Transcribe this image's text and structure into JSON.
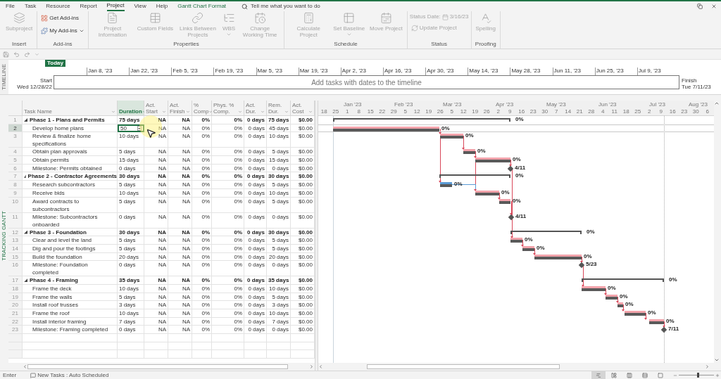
{
  "tabs": [
    {
      "label": "File",
      "selected": false,
      "kind": "tab"
    },
    {
      "label": "Task",
      "selected": false,
      "kind": "tab"
    },
    {
      "label": "Resource",
      "selected": false,
      "kind": "tab"
    },
    {
      "label": "Report",
      "selected": false,
      "kind": "tab"
    },
    {
      "label": "Project",
      "selected": true,
      "kind": "tab"
    },
    {
      "label": "View",
      "selected": false,
      "kind": "tab"
    },
    {
      "label": "Help",
      "selected": false,
      "kind": "tab"
    },
    {
      "label": "Gantt Chart Format",
      "selected": false,
      "kind": "contextual"
    }
  ],
  "search": {
    "placeholder": "Tell me what you want to do"
  },
  "ribbon": [
    {
      "label": "Insert",
      "buttons": [
        {
          "kind": "large",
          "label": "Subproject",
          "disabled": true,
          "menu": false
        }
      ]
    },
    {
      "label": "Add-ins",
      "buttons": [
        {
          "kind": "small",
          "label": "Get Add-ins",
          "disabled": false,
          "menu": false
        },
        {
          "kind": "small",
          "label": "My Add-ins",
          "disabled": false,
          "menu": true
        }
      ]
    },
    {
      "label": "Properties",
      "buttons": [
        {
          "kind": "large",
          "label": "Project Information",
          "disabled": true,
          "menu": false
        },
        {
          "kind": "large",
          "label": "Custom Fields",
          "disabled": true,
          "menu": false
        },
        {
          "kind": "large",
          "label": "Links Between Projects",
          "disabled": true,
          "menu": false
        },
        {
          "kind": "large",
          "label": "WBS",
          "disabled": true,
          "menu": true
        },
        {
          "kind": "large",
          "label": "Change Working Time",
          "disabled": true,
          "menu": false
        }
      ]
    },
    {
      "label": "Schedule",
      "buttons": [
        {
          "kind": "large",
          "label": "Calculate Project",
          "disabled": true,
          "menu": false
        },
        {
          "kind": "large",
          "label": "Set Baseline",
          "disabled": true,
          "menu": true
        },
        {
          "kind": "large",
          "label": "Move Project",
          "disabled": true,
          "menu": false
        }
      ]
    },
    {
      "label": "Status",
      "buttons": [
        {
          "kind": "field",
          "label": "Status Date:",
          "value": "3/16/23",
          "disabled": true,
          "menu": false
        },
        {
          "kind": "small",
          "label": "Update Project",
          "disabled": true,
          "menu": false
        }
      ]
    },
    {
      "label": "Proofing",
      "buttons": [
        {
          "kind": "large",
          "label": "Spelling",
          "disabled": true,
          "menu": false
        }
      ]
    }
  ],
  "timeline": {
    "side_label": "TIMELINE",
    "today": "Today",
    "start_label": "Start",
    "start_date": "Wed 12/28/22",
    "finish_label": "Finish",
    "finish_date": "Tue 7/11/23",
    "placeholder": "Add tasks with dates to the timeline",
    "dates": [
      "Jan 8, '23",
      "Jan 22, '23",
      "Feb 5, '23",
      "Feb 19, '23",
      "Mar 5, '23",
      "Mar 19, '23",
      "Apr 2, '23",
      "Apr 16, '23",
      "Apr 30, '23",
      "May 14, '23",
      "May 28, '23",
      "Jun 11, '23",
      "Jun 25, '23",
      "Jul 9, '23"
    ]
  },
  "view": {
    "side_label": "TRACKING GANTT",
    "columns": [
      {
        "label": "Task Name",
        "selected": false
      },
      {
        "label": "Duration",
        "selected": true
      },
      {
        "label": "Act. Start",
        "selected": false
      },
      {
        "label": "Act. Finish",
        "selected": false
      },
      {
        "label": "% Comp",
        "selected": false
      },
      {
        "label": "Phys. % Comp.",
        "selected": false
      },
      {
        "label": "Act. Dur.",
        "selected": false
      },
      {
        "label": "Rem. Dur.",
        "selected": false
      },
      {
        "label": "Act. Cost",
        "selected": false
      }
    ],
    "months": [
      "Jan '23",
      "Feb '23",
      "Mar '23",
      "Apr '23",
      "May '23",
      "Jun '23",
      "Jul '23",
      "Aug '23"
    ],
    "weeks": [
      "18",
      "25",
      "1",
      "8",
      "15",
      "22",
      "29",
      "5",
      "12",
      "19",
      "26",
      "5",
      "12",
      "19",
      "26",
      "2",
      "9",
      "16",
      "23",
      "30",
      "7",
      "14",
      "21",
      "28",
      "4",
      "11",
      "18",
      "25",
      "2",
      "9",
      "16",
      "23",
      "30",
      "6"
    ]
  },
  "tasks": [
    {
      "num": "1",
      "name": "Phase 1 - Plans and Permits",
      "kind": "summary",
      "expanded": true,
      "critical": true,
      "selected": false,
      "editing": false,
      "duration": "75 days",
      "act_start": "NA",
      "act_finish": "NA",
      "pct_comp": "0%",
      "phys_comp": "0%",
      "act_dur": "0 days",
      "rem_dur": "75 days",
      "act_cost": "$0.00",
      "bar_label": "0%"
    },
    {
      "num": "2",
      "name": "Develop home plans",
      "kind": "task",
      "critical": true,
      "selected": true,
      "editing": true,
      "duration": "50",
      "act_start": "NA",
      "act_finish": "NA",
      "pct_comp": "0%",
      "phys_comp": "0%",
      "act_dur": "0 days",
      "rem_dur": "45 days",
      "act_cost": "$0.00",
      "bar_label": "0%"
    },
    {
      "num": "3",
      "name": "Review & finalize home specifications",
      "kind": "task",
      "critical": true,
      "selected": false,
      "editing": false,
      "duration": "10 days",
      "act_start": "NA",
      "act_finish": "NA",
      "pct_comp": "0%",
      "phys_comp": "0%",
      "act_dur": "0 days",
      "rem_dur": "10 days",
      "act_cost": "$0.00",
      "bar_label": "0%"
    },
    {
      "num": "4",
      "name": "Obtain plan approvals",
      "kind": "task",
      "critical": true,
      "selected": false,
      "editing": false,
      "duration": "5 days",
      "act_start": "NA",
      "act_finish": "NA",
      "pct_comp": "0%",
      "phys_comp": "0%",
      "act_dur": "0 days",
      "rem_dur": "5 days",
      "act_cost": "$0.00",
      "bar_label": "0%"
    },
    {
      "num": "5",
      "name": "Obtain permits",
      "kind": "task",
      "critical": true,
      "selected": false,
      "editing": false,
      "duration": "15 days",
      "act_start": "NA",
      "act_finish": "NA",
      "pct_comp": "0%",
      "phys_comp": "0%",
      "act_dur": "0 days",
      "rem_dur": "15 days",
      "act_cost": "$0.00",
      "bar_label": "0%"
    },
    {
      "num": "6",
      "name": "Milestone: Permits obtained",
      "kind": "milestone",
      "critical": true,
      "selected": false,
      "editing": false,
      "duration": "0 days",
      "act_start": "NA",
      "act_finish": "NA",
      "pct_comp": "0%",
      "phys_comp": "0%",
      "act_dur": "0 days",
      "rem_dur": "0 days",
      "act_cost": "$0.00",
      "bar_label": "4/11"
    },
    {
      "num": "7",
      "name": "Phase 2 - Contractor Agreements",
      "kind": "summary",
      "expanded": true,
      "critical": true,
      "selected": false,
      "editing": false,
      "duration": "30 days",
      "act_start": "NA",
      "act_finish": "NA",
      "pct_comp": "0%",
      "phys_comp": "0%",
      "act_dur": "0 days",
      "rem_dur": "30 days",
      "act_cost": "$0.00",
      "bar_label": "0%"
    },
    {
      "num": "8",
      "name": "Research subcontractors",
      "kind": "task",
      "critical": false,
      "selected": false,
      "editing": false,
      "duration": "5 days",
      "act_start": "NA",
      "act_finish": "NA",
      "pct_comp": "0%",
      "phys_comp": "0%",
      "act_dur": "0 days",
      "rem_dur": "5 days",
      "act_cost": "$0.00",
      "bar_label": "0%"
    },
    {
      "num": "9",
      "name": "Receive bids",
      "kind": "task",
      "critical": true,
      "selected": false,
      "editing": false,
      "duration": "10 days",
      "act_start": "NA",
      "act_finish": "NA",
      "pct_comp": "0%",
      "phys_comp": "0%",
      "act_dur": "0 days",
      "rem_dur": "10 days",
      "act_cost": "$0.00",
      "bar_label": "0%"
    },
    {
      "num": "10",
      "name": "Award contracts to subcontractors",
      "kind": "task",
      "critical": true,
      "selected": false,
      "editing": false,
      "duration": "5 days",
      "act_start": "NA",
      "act_finish": "NA",
      "pct_comp": "0%",
      "phys_comp": "0%",
      "act_dur": "0 days",
      "rem_dur": "5 days",
      "act_cost": "$0.00",
      "bar_label": "0%"
    },
    {
      "num": "11",
      "name": "Milestone: Subcontractors onboarded",
      "kind": "milestone",
      "critical": true,
      "selected": false,
      "editing": false,
      "duration": "0 days",
      "act_start": "NA",
      "act_finish": "NA",
      "pct_comp": "0%",
      "phys_comp": "0%",
      "act_dur": "0 days",
      "rem_dur": "0 days",
      "act_cost": "$0.00",
      "bar_label": "4/11"
    },
    {
      "num": "12",
      "name": "Phase 3 - Foundation",
      "kind": "summary",
      "expanded": true,
      "critical": true,
      "selected": false,
      "editing": false,
      "duration": "30 days",
      "act_start": "NA",
      "act_finish": "NA",
      "pct_comp": "0%",
      "phys_comp": "0%",
      "act_dur": "0 days",
      "rem_dur": "30 days",
      "act_cost": "$0.00",
      "bar_label": "0%"
    },
    {
      "num": "13",
      "name": "Clear and level the land",
      "kind": "task",
      "critical": true,
      "selected": false,
      "editing": false,
      "duration": "5 days",
      "act_start": "NA",
      "act_finish": "NA",
      "pct_comp": "0%",
      "phys_comp": "0%",
      "act_dur": "0 days",
      "rem_dur": "5 days",
      "act_cost": "$0.00",
      "bar_label": "0%"
    },
    {
      "num": "14",
      "name": "Dig and pour the footings",
      "kind": "task",
      "critical": true,
      "selected": false,
      "editing": false,
      "duration": "5 days",
      "act_start": "NA",
      "act_finish": "NA",
      "pct_comp": "0%",
      "phys_comp": "0%",
      "act_dur": "0 days",
      "rem_dur": "5 days",
      "act_cost": "$0.00",
      "bar_label": "0%"
    },
    {
      "num": "15",
      "name": "Build the foundation",
      "kind": "task",
      "critical": true,
      "selected": false,
      "editing": false,
      "duration": "20 days",
      "act_start": "NA",
      "act_finish": "NA",
      "pct_comp": "0%",
      "phys_comp": "0%",
      "act_dur": "0 days",
      "rem_dur": "20 days",
      "act_cost": "$0.00",
      "bar_label": "0%"
    },
    {
      "num": "16",
      "name": "Milestone: Foundation completed",
      "kind": "milestone",
      "critical": true,
      "selected": false,
      "editing": false,
      "duration": "0 days",
      "act_start": "NA",
      "act_finish": "NA",
      "pct_comp": "0%",
      "phys_comp": "0%",
      "act_dur": "0 days",
      "rem_dur": "0 days",
      "act_cost": "$0.00",
      "bar_label": "5/23"
    },
    {
      "num": "17",
      "name": "Phase 4 - Framing",
      "kind": "summary",
      "expanded": true,
      "critical": true,
      "selected": false,
      "editing": false,
      "duration": "35 days",
      "act_start": "NA",
      "act_finish": "NA",
      "pct_comp": "0%",
      "phys_comp": "0%",
      "act_dur": "0 days",
      "rem_dur": "35 days",
      "act_cost": "$0.00",
      "bar_label": "0%"
    },
    {
      "num": "18",
      "name": "Frame the deck",
      "kind": "task",
      "critical": true,
      "selected": false,
      "editing": false,
      "duration": "10 days",
      "act_start": "NA",
      "act_finish": "NA",
      "pct_comp": "0%",
      "phys_comp": "0%",
      "act_dur": "0 days",
      "rem_dur": "10 days",
      "act_cost": "$0.00",
      "bar_label": "0%"
    },
    {
      "num": "19",
      "name": "Frame the walls",
      "kind": "task",
      "critical": true,
      "selected": false,
      "editing": false,
      "duration": "5 days",
      "act_start": "NA",
      "act_finish": "NA",
      "pct_comp": "0%",
      "phys_comp": "0%",
      "act_dur": "0 days",
      "rem_dur": "5 days",
      "act_cost": "$0.00",
      "bar_label": "0%"
    },
    {
      "num": "20",
      "name": "Install roof trusses",
      "kind": "task",
      "critical": true,
      "selected": false,
      "editing": false,
      "duration": "3 days",
      "act_start": "NA",
      "act_finish": "NA",
      "pct_comp": "0%",
      "phys_comp": "0%",
      "act_dur": "0 days",
      "rem_dur": "3 days",
      "act_cost": "$0.00",
      "bar_label": "0%"
    },
    {
      "num": "21",
      "name": "Frame the roof",
      "kind": "task",
      "critical": true,
      "selected": false,
      "editing": false,
      "duration": "10 days",
      "act_start": "NA",
      "act_finish": "NA",
      "pct_comp": "0%",
      "phys_comp": "0%",
      "act_dur": "0 days",
      "rem_dur": "10 days",
      "act_cost": "$0.00",
      "bar_label": "0%"
    },
    {
      "num": "22",
      "name": "Install interior framing",
      "kind": "task",
      "critical": true,
      "selected": false,
      "editing": false,
      "duration": "7 days",
      "act_start": "NA",
      "act_finish": "NA",
      "pct_comp": "0%",
      "phys_comp": "0%",
      "act_dur": "0 days",
      "rem_dur": "7 days",
      "act_cost": "$0.00",
      "bar_label": "0%"
    },
    {
      "num": "23",
      "name": "Milestone: Framing completed",
      "kind": "milestone",
      "critical": true,
      "selected": false,
      "editing": false,
      "duration": "0 days",
      "act_start": "NA",
      "act_finish": "NA",
      "pct_comp": "0%",
      "phys_comp": "0%",
      "act_dur": "0 days",
      "rem_dur": "0 days",
      "act_cost": "$0.00",
      "bar_label": "7/11"
    }
  ],
  "status_bar": {
    "mode": "Enter",
    "new_tasks": "New Tasks : Auto Scheduled",
    "views": [
      {
        "selected": true
      },
      {
        "selected": false
      },
      {
        "selected": false
      },
      {
        "selected": false
      },
      {
        "selected": false
      }
    ],
    "zoom": {
      "level": 0.55
    }
  }
}
